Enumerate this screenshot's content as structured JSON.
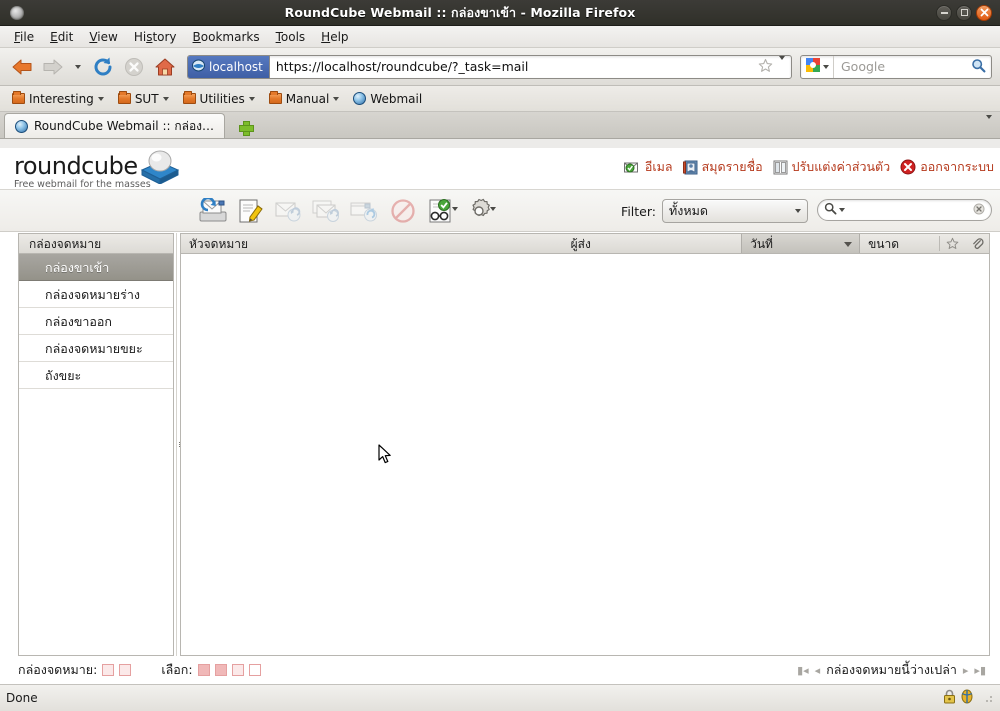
{
  "window": {
    "title": "RoundCube Webmail :: กล่องขาเข้า - Mozilla Firefox",
    "app_icon": "firefox-window-icon",
    "controls": [
      {
        "name": "minimize-button",
        "label": "–"
      },
      {
        "name": "maximize-button",
        "label": "□"
      },
      {
        "name": "close-button",
        "label": "×"
      }
    ]
  },
  "menubar": {
    "items": [
      {
        "label": "File",
        "accel": "F"
      },
      {
        "label": "Edit",
        "accel": "E"
      },
      {
        "label": "View",
        "accel": "V"
      },
      {
        "label": "History",
        "accel": "s"
      },
      {
        "label": "Bookmarks",
        "accel": "B"
      },
      {
        "label": "Tools",
        "accel": "T"
      },
      {
        "label": "Help",
        "accel": "H"
      }
    ]
  },
  "navbar": {
    "back_icon": "back-arrow-icon",
    "forward_icon": "forward-arrow-icon",
    "history_dropdown_icon": "chevron-down-icon",
    "reload_icon": "reload-icon",
    "stop_icon": "stop-icon",
    "home_icon": "home-icon",
    "identity_label": "localhost",
    "url": "https://localhost/roundcube/?_task=mail",
    "bookmark_star_icon": "star-icon",
    "bookmark_dropdown_icon": "chevron-down-icon",
    "search_engine": "Google",
    "search_placeholder": "Google",
    "search_value": "",
    "search_go_icon": "magnifier-icon"
  },
  "bookmarks": {
    "items": [
      {
        "label": "Interesting",
        "icon": "folder-icon",
        "has_dropdown": true
      },
      {
        "label": "SUT",
        "icon": "folder-icon",
        "has_dropdown": true
      },
      {
        "label": "Utilities",
        "icon": "folder-icon",
        "has_dropdown": true
      },
      {
        "label": "Manual",
        "icon": "folder-icon",
        "has_dropdown": true
      },
      {
        "label": "Webmail",
        "icon": "globe-icon",
        "has_dropdown": false
      }
    ]
  },
  "tabs": {
    "items": [
      {
        "label": "RoundCube Webmail :: กล่อง…",
        "favicon": "globe-icon",
        "active": true
      }
    ],
    "new_tab_icon": "plus-icon",
    "tab_list_icon": "chevron-down-icon"
  },
  "roundcube": {
    "logo_word": "roundcube",
    "logo_tagline": "Free webmail for the masses",
    "tasks": [
      {
        "label": "อีเมล",
        "icon": "mail-task-icon",
        "name": "task-mail"
      },
      {
        "label": "สมุดรายชื่อ",
        "icon": "addressbook-task-icon",
        "name": "task-addressbook"
      },
      {
        "label": "ปรับแต่งค่าส่วนตัว",
        "icon": "settings-task-icon",
        "name": "task-settings"
      },
      {
        "label": "ออกจากระบบ",
        "icon": "logout-task-icon",
        "name": "task-logout"
      }
    ],
    "toolbar": [
      {
        "name": "check-mail-button",
        "icon": "check-mail-icon",
        "disabled": false,
        "dropdown": false
      },
      {
        "name": "compose-button",
        "icon": "compose-icon",
        "disabled": false,
        "dropdown": false
      },
      {
        "name": "reply-button",
        "icon": "reply-icon",
        "disabled": true,
        "dropdown": false
      },
      {
        "name": "reply-all-button",
        "icon": "reply-all-icon",
        "disabled": true,
        "dropdown": false
      },
      {
        "name": "forward-button",
        "icon": "forward-icon",
        "disabled": true,
        "dropdown": false
      },
      {
        "name": "delete-button",
        "icon": "delete-icon",
        "disabled": true,
        "dropdown": false
      },
      {
        "name": "mark-button",
        "icon": "mark-read-icon",
        "disabled": false,
        "dropdown": true
      },
      {
        "name": "more-actions-button",
        "icon": "gear-icon",
        "disabled": false,
        "dropdown": true
      }
    ],
    "filter_label": "Filter:",
    "filter_value": "ทั้งหมด",
    "filter_dropdown_icon": "chevron-down-icon",
    "search_placeholder": "",
    "search_value": "",
    "search_icon": "magnifier-icon",
    "search_clear_icon": "clear-icon",
    "folders": {
      "header": "กล่องจดหมาย",
      "items": [
        {
          "label": "กล่องขาเข้า",
          "selected": true,
          "name": "folder-inbox"
        },
        {
          "label": "กล่องจดหมายร่าง",
          "selected": false,
          "name": "folder-drafts"
        },
        {
          "label": "กล่องขาออก",
          "selected": false,
          "name": "folder-sent"
        },
        {
          "label": "กล่องจดหมายขยะ",
          "selected": false,
          "name": "folder-junk"
        },
        {
          "label": "ถังขยะ",
          "selected": false,
          "name": "folder-trash"
        }
      ]
    },
    "message_list": {
      "columns": [
        {
          "label": "หัวจดหมาย",
          "name": "column-subject",
          "sorted": false
        },
        {
          "label": "ผู้ส่ง",
          "name": "column-sender",
          "sorted": false
        },
        {
          "label": "วันที่",
          "name": "column-date",
          "sorted": true
        },
        {
          "label": "ขนาด",
          "name": "column-size",
          "sorted": false
        }
      ],
      "flag_column_icon": "star-icon",
      "attachment_column_icon": "paperclip-icon",
      "rows": []
    },
    "footer": {
      "mailbox_label": "กล่องจดหมาย:",
      "mailbox_actions": [
        {
          "name": "select-all-icon"
        },
        {
          "name": "purge-icon"
        }
      ],
      "select_label": "เลือก:",
      "select_actions": [
        {
          "name": "select-all-messages-icon"
        },
        {
          "name": "select-unread-icon"
        },
        {
          "name": "select-invert-icon"
        },
        {
          "name": "select-none-icon"
        }
      ],
      "empty_message": "กล่องจดหมายนี้ว่างเปล่า",
      "pager": {
        "first_icon": "page-first-icon",
        "prev_icon": "page-prev-icon",
        "next_icon": "page-next-icon",
        "last_icon": "page-last-icon"
      }
    }
  },
  "statusbar": {
    "text": "Done",
    "lock_icon": "lock-icon",
    "identity_icon": "identity-globe-icon"
  }
}
